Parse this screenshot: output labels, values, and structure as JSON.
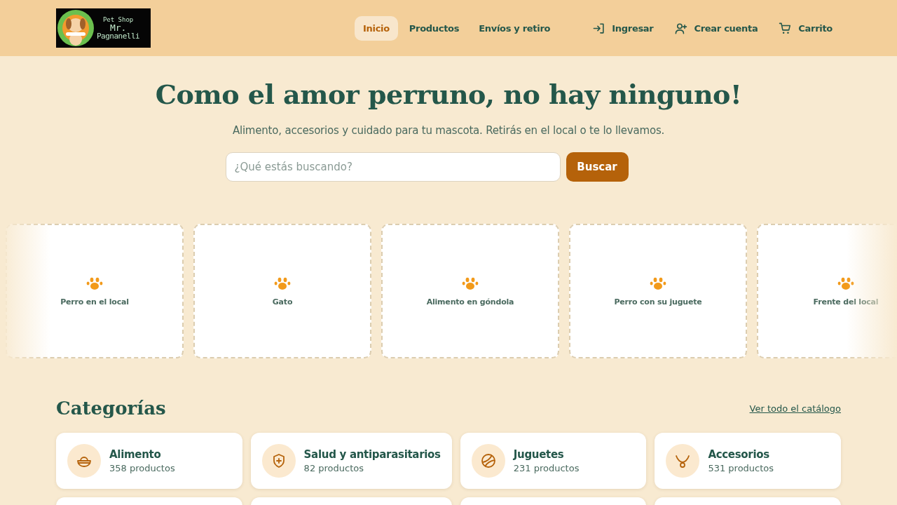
{
  "header": {
    "logo": {
      "line_1": "Pet Shop",
      "line_2": "Mr.",
      "line_3": "Pagnanelli"
    },
    "nav": [
      {
        "label": "Inicio",
        "selected": true
      },
      {
        "label": "Productos",
        "selected": false
      },
      {
        "label": "Envíos y retiro",
        "selected": false
      }
    ],
    "actions": [
      {
        "kind": "login",
        "label": "Ingresar"
      },
      {
        "kind": "signup",
        "label": "Crear cuenta"
      },
      {
        "kind": "cart",
        "label": "Carrito"
      }
    ]
  },
  "hero": {
    "title": "Como el amor perruno, no hay ninguno!",
    "subtitle": "Alimento, accesorios y cuidado para tu mascota. Retirás en el local o te lo llevamos.",
    "search": {
      "placeholder": "¿Qué estás buscando?",
      "button": "Buscar"
    }
  },
  "gallery": [
    {
      "label": "Perro en el local"
    },
    {
      "label": "Gato"
    },
    {
      "label": "Alimento en góndola"
    },
    {
      "label": "Perro con su juguete"
    },
    {
      "label": "Frente del local"
    }
  ],
  "categories": {
    "title": "Categorías",
    "link": "Ver todo el catálogo",
    "items": [
      {
        "kind": "food",
        "name": "Alimento",
        "count": "358 productos"
      },
      {
        "kind": "health",
        "name": "Salud y antiparasitarios",
        "count": "82 productos"
      },
      {
        "kind": "toys",
        "name": "Juguetes",
        "count": "231 productos"
      },
      {
        "kind": "accessories",
        "name": "Accesorios",
        "count": "531 productos"
      }
    ]
  }
}
